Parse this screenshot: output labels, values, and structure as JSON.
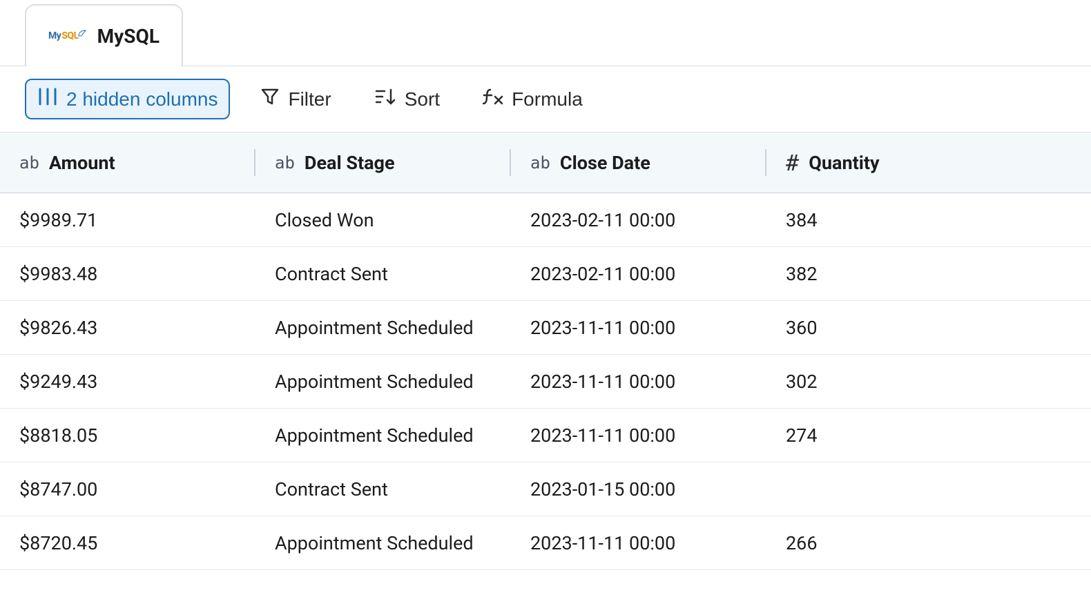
{
  "tab": {
    "label": "MySQL",
    "logo_my": "My",
    "logo_sql": "SQL"
  },
  "toolbar": {
    "hidden_columns_label": "2 hidden columns",
    "filter_label": "Filter",
    "sort_label": "Sort",
    "formula_label": "Formula"
  },
  "columns": [
    {
      "type": "ab",
      "label": "Amount"
    },
    {
      "type": "ab",
      "label": "Deal Stage"
    },
    {
      "type": "ab",
      "label": "Close Date"
    },
    {
      "type": "hash",
      "label": "Quantity"
    }
  ],
  "rows": [
    {
      "amount": "$9989.71",
      "stage": "Closed Won",
      "close_date": "2023-02-11 00:00",
      "quantity": "384"
    },
    {
      "amount": "$9983.48",
      "stage": "Contract Sent",
      "close_date": "2023-02-11 00:00",
      "quantity": "382"
    },
    {
      "amount": "$9826.43",
      "stage": "Appointment Scheduled",
      "close_date": "2023-11-11 00:00",
      "quantity": "360"
    },
    {
      "amount": "$9249.43",
      "stage": "Appointment Scheduled",
      "close_date": "2023-11-11 00:00",
      "quantity": "302"
    },
    {
      "amount": "$8818.05",
      "stage": "Appointment Scheduled",
      "close_date": "2023-11-11 00:00",
      "quantity": "274"
    },
    {
      "amount": "$8747.00",
      "stage": "Contract Sent",
      "close_date": "2023-01-15 00:00",
      "quantity": ""
    },
    {
      "amount": "$8720.45",
      "stage": "Appointment Scheduled",
      "close_date": "2023-11-11 00:00",
      "quantity": "266"
    }
  ]
}
